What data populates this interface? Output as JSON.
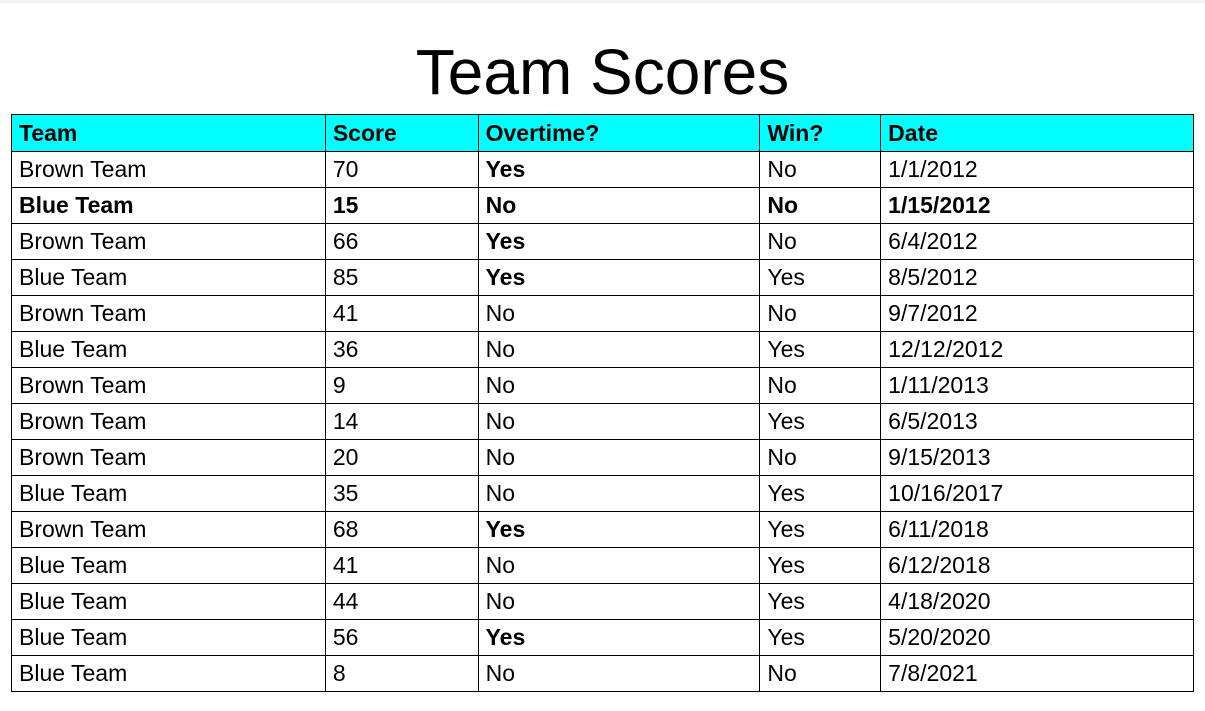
{
  "title": "Team Scores",
  "columns": [
    "Team",
    "Score",
    "Overtime?",
    "Win?",
    "Date"
  ],
  "rows": [
    {
      "team": "Brown Team",
      "score": "70",
      "overtime": "Yes",
      "win": "No",
      "date": "1/1/2012",
      "bold": false
    },
    {
      "team": "Blue Team",
      "score": "15",
      "overtime": "No",
      "win": "No",
      "date": "1/15/2012",
      "bold": true
    },
    {
      "team": "Brown Team",
      "score": "66",
      "overtime": "Yes",
      "win": "No",
      "date": "6/4/2012",
      "bold": false
    },
    {
      "team": "Blue Team",
      "score": "85",
      "overtime": "Yes",
      "win": "Yes",
      "date": "8/5/2012",
      "bold": false
    },
    {
      "team": "Brown Team",
      "score": "41",
      "overtime": "No",
      "win": "No",
      "date": "9/7/2012",
      "bold": false
    },
    {
      "team": "Blue Team",
      "score": "36",
      "overtime": "No",
      "win": "Yes",
      "date": "12/12/2012",
      "bold": false
    },
    {
      "team": "Brown Team",
      "score": "9",
      "overtime": "No",
      "win": "No",
      "date": "1/11/2013",
      "bold": false
    },
    {
      "team": "Brown Team",
      "score": "14",
      "overtime": "No",
      "win": "Yes",
      "date": "6/5/2013",
      "bold": false
    },
    {
      "team": "Brown Team",
      "score": "20",
      "overtime": "No",
      "win": "No",
      "date": "9/15/2013",
      "bold": false
    },
    {
      "team": "Blue Team",
      "score": "35",
      "overtime": "No",
      "win": "Yes",
      "date": "10/16/2017",
      "bold": false
    },
    {
      "team": "Brown Team",
      "score": "68",
      "overtime": "Yes",
      "win": "Yes",
      "date": "6/11/2018",
      "bold": false
    },
    {
      "team": "Blue Team",
      "score": "41",
      "overtime": "No",
      "win": "Yes",
      "date": "6/12/2018",
      "bold": false
    },
    {
      "team": "Blue Team",
      "score": "44",
      "overtime": "No",
      "win": "Yes",
      "date": "4/18/2020",
      "bold": false
    },
    {
      "team": "Blue Team",
      "score": "56",
      "overtime": "Yes",
      "win": "Yes",
      "date": "5/20/2020",
      "bold": false
    },
    {
      "team": "Blue Team",
      "score": "8",
      "overtime": "No",
      "win": "No",
      "date": "7/8/2021",
      "bold": false
    }
  ],
  "colors": {
    "header_background": "#00ffff",
    "border": "#000000"
  }
}
